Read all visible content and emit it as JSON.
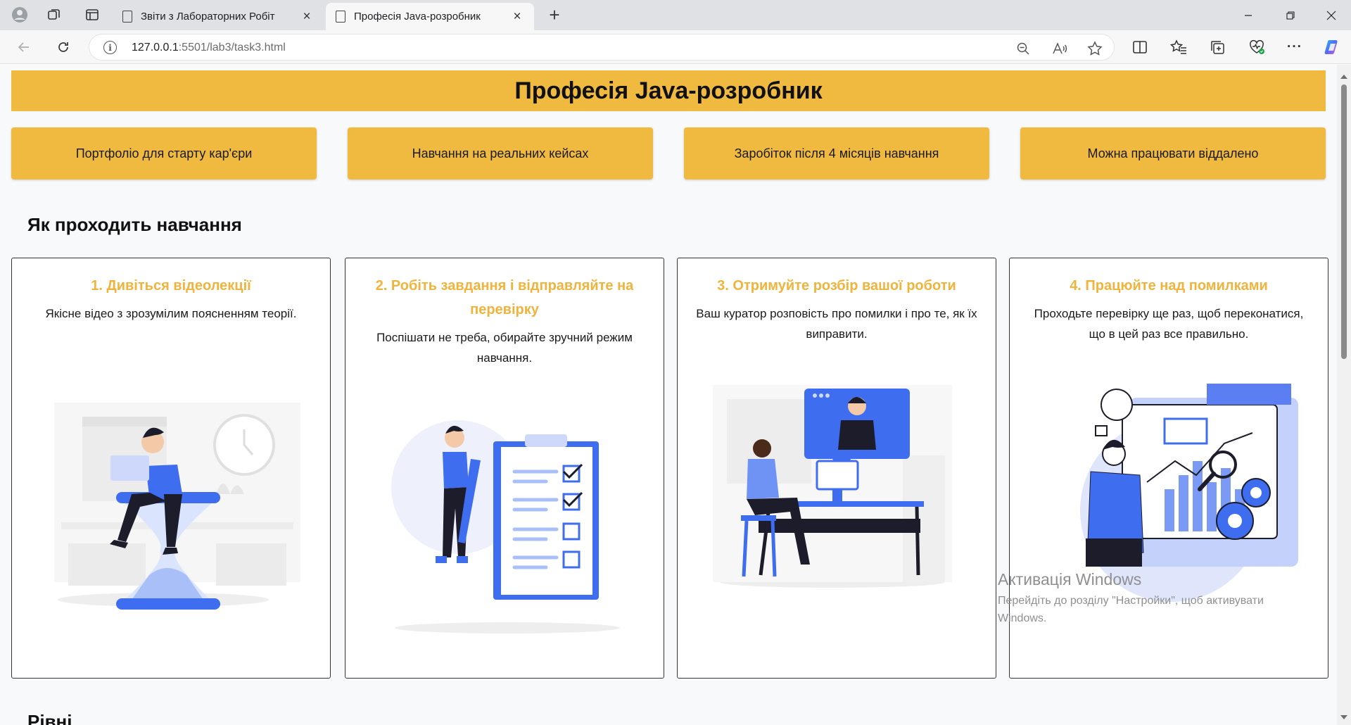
{
  "browser": {
    "tabs": [
      {
        "title": "Звіти з Лабораторних Робіт",
        "active": false
      },
      {
        "title": "Професія Java-розробник",
        "active": true
      }
    ],
    "url_host": "127.0.0.1",
    "url_rest": ":5501/lab3/task3.html"
  },
  "page": {
    "title": "Професія Java-розробник",
    "features": [
      "Портфоліо для старту кар'єри",
      "Навчання на реальних кейсах",
      "Заробіток після 4 місяців навчання",
      "Можна працювати віддалено"
    ],
    "section_title": "Як проходить навчання",
    "steps": [
      {
        "title": "1. Дивіться відеолекції",
        "text": "Якісне відео з зрозумілим поясненням теорії."
      },
      {
        "title": "2. Робіть завдання і відправляйте на перевірку",
        "text": "Поспішати не треба, обирайте зручний режим навчання."
      },
      {
        "title": "3. Отримуйте розбір вашої роботи",
        "text": "Ваш куратор розповість про помилки і про те, як їх виправити."
      },
      {
        "title": "4. Працюйте над помилками",
        "text": "Проходьте перевірку ще раз, щоб переконатися, що в цей раз все правильно."
      }
    ],
    "next_section_partial": "Рівні"
  },
  "watermark": {
    "line1": "Активація Windows",
    "line2": "Перейдіть до розділу \"Настройки\", щоб активувати Windows."
  },
  "colors": {
    "accent": "#f0b93f",
    "illustration_blue": "#3f6df0"
  }
}
